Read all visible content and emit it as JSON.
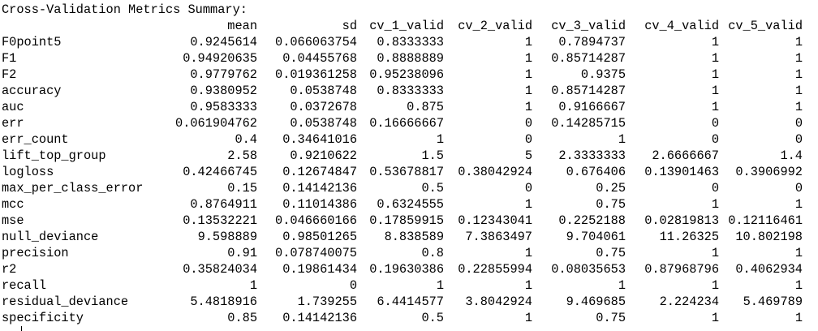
{
  "console": {
    "title": "Cross-Validation Metrics Summary:"
  },
  "table": {
    "columns": [
      "",
      "mean",
      "sd",
      "cv_1_valid",
      "cv_2_valid",
      "cv_3_valid",
      "cv_4_valid",
      "cv_5_valid"
    ],
    "rows": [
      [
        "F0point5",
        "0.9245614",
        "0.066063754",
        "0.8333333",
        "1",
        "0.7894737",
        "1",
        "1"
      ],
      [
        "F1",
        "0.94920635",
        "0.04455768",
        "0.8888889",
        "1",
        "0.85714287",
        "1",
        "1"
      ],
      [
        "F2",
        "0.9779762",
        "0.019361258",
        "0.95238096",
        "1",
        "0.9375",
        "1",
        "1"
      ],
      [
        "accuracy",
        "0.9380952",
        "0.0538748",
        "0.8333333",
        "1",
        "0.85714287",
        "1",
        "1"
      ],
      [
        "auc",
        "0.9583333",
        "0.0372678",
        "0.875",
        "1",
        "0.9166667",
        "1",
        "1"
      ],
      [
        "err",
        "0.061904762",
        "0.0538748",
        "0.16666667",
        "0",
        "0.14285715",
        "0",
        "0"
      ],
      [
        "err_count",
        "0.4",
        "0.34641016",
        "1",
        "0",
        "1",
        "0",
        "0"
      ],
      [
        "lift_top_group",
        "2.58",
        "0.9210622",
        "1.5",
        "5",
        "2.3333333",
        "2.6666667",
        "1.4"
      ],
      [
        "logloss",
        "0.42466745",
        "0.12674847",
        "0.53678817",
        "0.38042924",
        "0.676406",
        "0.13901463",
        "0.3906992"
      ],
      [
        "max_per_class_error",
        "0.15",
        "0.14142136",
        "0.5",
        "0",
        "0.25",
        "0",
        "0"
      ],
      [
        "mcc",
        "0.8764911",
        "0.11014386",
        "0.6324555",
        "1",
        "0.75",
        "1",
        "1"
      ],
      [
        "mse",
        "0.13532221",
        "0.046660166",
        "0.17859915",
        "0.12343041",
        "0.2252188",
        "0.02819813",
        "0.12116461"
      ],
      [
        "null_deviance",
        "9.598889",
        "0.98501265",
        "8.838589",
        "7.3863497",
        "9.704061",
        "11.26325",
        "10.802198"
      ],
      [
        "precision",
        "0.91",
        "0.078740075",
        "0.8",
        "1",
        "0.75",
        "1",
        "1"
      ],
      [
        "r2",
        "0.35824034",
        "0.19861434",
        "0.19630386",
        "0.22855994",
        "0.08035653",
        "0.87968796",
        "0.4062934"
      ],
      [
        "recall",
        "1",
        "0",
        "1",
        "1",
        "1",
        "1",
        "1"
      ],
      [
        "residual_deviance",
        "5.4818916",
        "1.739255",
        "6.4414577",
        "3.8042924",
        "9.469685",
        "2.224234",
        "5.469789"
      ],
      [
        "specificity",
        "0.85",
        "0.14142136",
        "0.5",
        "1",
        "0.75",
        "1",
        "1"
      ]
    ]
  }
}
